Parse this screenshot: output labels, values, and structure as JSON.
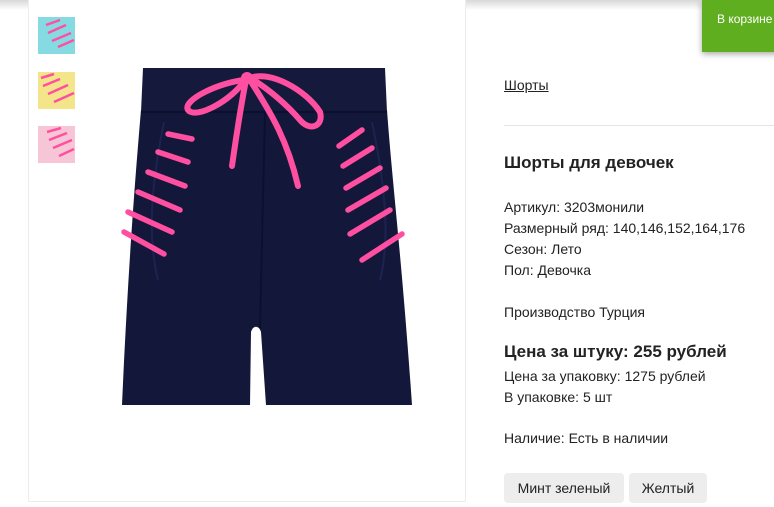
{
  "cart_notice": {
    "text": "В корзине"
  },
  "breadcrumb": {
    "label": "Шорты"
  },
  "product": {
    "title": "Шорты для девочек",
    "article": "Артикул: 3203монили",
    "sizes": "Размерный ряд: 140,146,152,164,176",
    "season": "Сезон: Лето",
    "gender": "Пол: Девочка",
    "production": "Производство Турция",
    "price_per_item": "Цена за штуку: 255 рублей",
    "price_per_pack": "Цена за упаковку: 1275 рублей",
    "pack_qty": "В упаковке: 5 шт",
    "availability": "Наличие: Есть в наличии"
  },
  "colors": [
    {
      "label": "Минт зеленый"
    },
    {
      "label": "Желтый"
    }
  ],
  "thumbnails": [
    {
      "color": "#86dbe3",
      "stripe_color": "#ff4fa0"
    },
    {
      "color": "#f4e48a",
      "stripe_color": "#ff4fa0"
    },
    {
      "color": "#f7c6d6",
      "stripe_color": "#ff4fa0"
    }
  ],
  "main_image": {
    "fabric_color": "#13173a",
    "accent_color": "#ff4fa0"
  }
}
